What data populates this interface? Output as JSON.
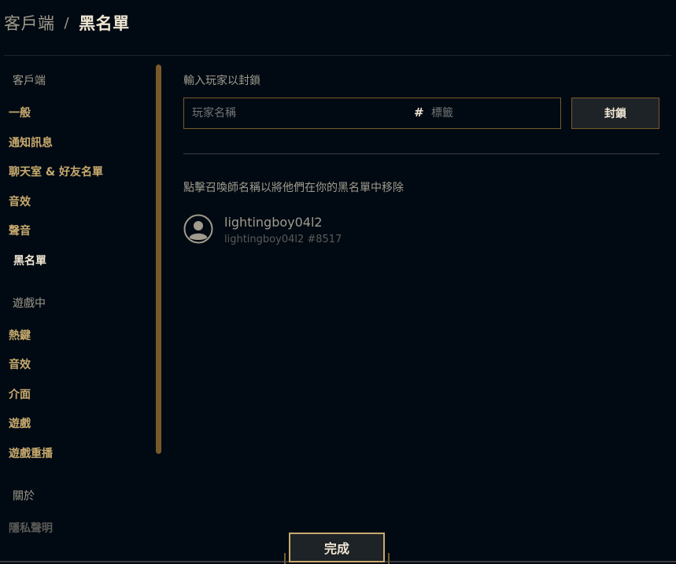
{
  "header": {
    "parent": "客戶端",
    "separator": "/",
    "current": "黑名單"
  },
  "sidebar": {
    "sections": [
      {
        "title": "客戶端",
        "items": [
          "一般",
          "通知訊息",
          "聊天室 & 好友名單",
          "音效",
          "聲音",
          "黑名單"
        ]
      },
      {
        "title": "遊戲中",
        "items": [
          "熱鍵",
          "音效",
          "介面",
          "遊戲",
          "遊戲重播"
        ]
      },
      {
        "title": "關於",
        "items": [
          "隱私聲明"
        ]
      }
    ],
    "active_item": "黑名單"
  },
  "block_form": {
    "label": "輸入玩家以封鎖",
    "name_placeholder": "玩家名稱",
    "tag_placeholder": "標籤",
    "hash_symbol": "#",
    "button_label": "封鎖"
  },
  "instruction": "點擊召喚師名稱以將他們在你的黑名單中移除",
  "blocked_players": [
    {
      "name": "lightingboy04l2",
      "tag_line": "lightingboy04l2 #8517"
    }
  ],
  "footer": {
    "done_label": "完成"
  },
  "colors": {
    "background": "#010a13",
    "gold": "#c8aa6e",
    "gold_dark": "#785a28",
    "text_light": "#f0e6d2",
    "text_muted": "#a09b8c"
  }
}
